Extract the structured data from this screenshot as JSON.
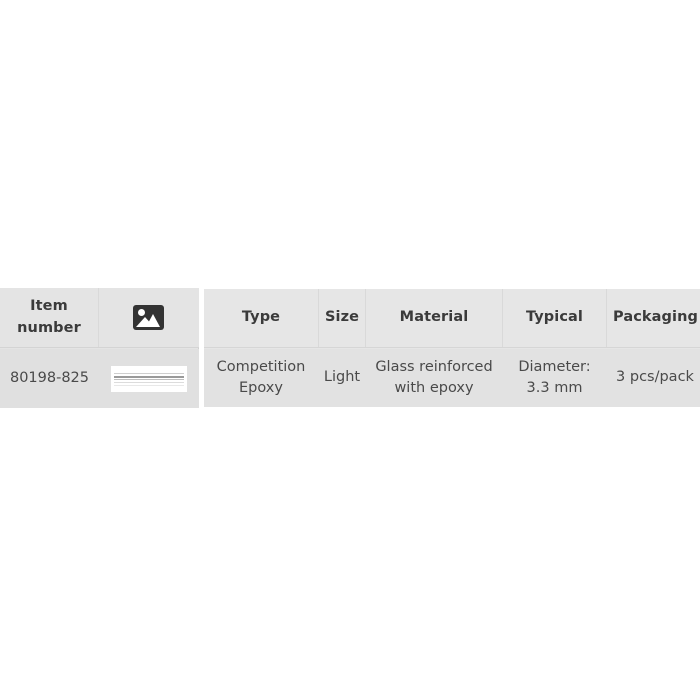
{
  "page": {
    "background_color": "#ffffff",
    "header_bg": "#e4e4e4",
    "row_bg": "#e0e0e0",
    "header_text_color": "#3b3b3b",
    "body_text_color": "#4a4a4a"
  },
  "item_table": {
    "headers": {
      "item_number": "Item\nnumber",
      "item_number_line1": "Item",
      "item_number_line2": "number",
      "image_icon": "image-icon"
    },
    "rows": [
      {
        "item_number": "80198-825",
        "thumbnail": "product-thumbnail"
      }
    ]
  },
  "spec_table": {
    "columns": [
      {
        "key": "type",
        "label": "Type"
      },
      {
        "key": "size",
        "label": "Size"
      },
      {
        "key": "material",
        "label": "Material"
      },
      {
        "key": "typical",
        "label": "Typical"
      },
      {
        "key": "packaging",
        "label": "Packaging"
      }
    ],
    "rows": [
      {
        "type_line1": "Competition",
        "type_line2": "Epoxy",
        "type": "Competition Epoxy",
        "size": "Light",
        "material_line1": "Glass reinforced",
        "material_line2": "with epoxy",
        "material": "Glass reinforced with epoxy",
        "typical_line1": "Diameter:",
        "typical_line2": "3.3 mm",
        "typical": "Diameter: 3.3 mm",
        "packaging": "3 pcs/pack"
      }
    ]
  }
}
